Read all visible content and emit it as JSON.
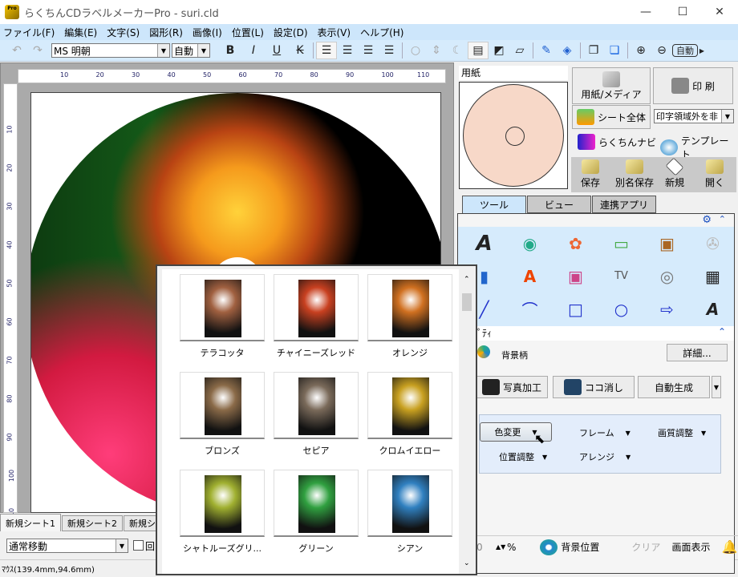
{
  "window": {
    "title": "らくちんCDラベルメーカーPro - suri.cld",
    "logo_text": "Pro",
    "minimize": "—",
    "maximize": "☐",
    "close": "✕"
  },
  "menu": [
    "ファイル(F)",
    "編集(E)",
    "文字(S)",
    "図形(R)",
    "画像(I)",
    "位置(L)",
    "設定(D)",
    "表示(V)",
    "ヘルプ(H)"
  ],
  "toolbar": {
    "font": "MS 明朝",
    "size": "自動",
    "zoom_auto": "自動",
    "bold": "B",
    "italic": "I",
    "underline": "U",
    "strike": "K"
  },
  "ruler": {
    "h": [
      "10",
      "20",
      "30",
      "40",
      "50",
      "60",
      "70",
      "80",
      "90",
      "100",
      "110"
    ],
    "v": [
      "10",
      "20",
      "30",
      "40",
      "50",
      "60",
      "70",
      "80",
      "90",
      "100",
      "110"
    ]
  },
  "sheets": [
    "新規シート1",
    "新規シート2",
    "新規シー"
  ],
  "move_mode": "通常移動",
  "rotate_label": "回",
  "status": {
    "mouse": "ﾏｳｽ(139.4mm,94.6mm)"
  },
  "right": {
    "paper_label": "用紙",
    "media_button": "用紙/メディア",
    "print_button": "印 刷",
    "sheet_all_button": "シート全体",
    "print_area_select": "印字領域外を非",
    "navi": "らくちんナビ",
    "template": "テンプレート",
    "quick": [
      "保存",
      "別名保存",
      "新規",
      "開く"
    ],
    "tabs": [
      "ツール",
      "ビュー",
      "連携アプリ"
    ],
    "property_header": "ﾊﾟﾃｨ",
    "background_label": "背景柄",
    "detail_button": "詳細...",
    "photo_edit": "写真加工",
    "erase": "ココ消し",
    "auto_gen": "自動生成",
    "sub": {
      "color_change": "色変更",
      "frame": "フレーム",
      "quality": "画質調整",
      "position": "位置調整",
      "arrange": "アレンジ"
    }
  },
  "bottom": {
    "percent_value": "0",
    "percent_unit": "%",
    "bg_position": "背景位置",
    "clear": "クリア",
    "screen": "画面表示"
  },
  "color_presets": [
    {
      "label": "テラコッタ",
      "color": "#a06040"
    },
    {
      "label": "チャイニーズレッド",
      "color": "#c84020"
    },
    {
      "label": "オレンジ",
      "color": "#d07020"
    },
    {
      "label": "ブロンズ",
      "color": "#8a6a48"
    },
    {
      "label": "セピア",
      "color": "#7a6a5a"
    },
    {
      "label": "クロムイエロー",
      "color": "#c8a020"
    },
    {
      "label": "シャトルーズグリ...",
      "color": "#a0b030"
    },
    {
      "label": "グリーン",
      "color": "#30a040"
    },
    {
      "label": "シアン",
      "color": "#3080c0"
    }
  ]
}
